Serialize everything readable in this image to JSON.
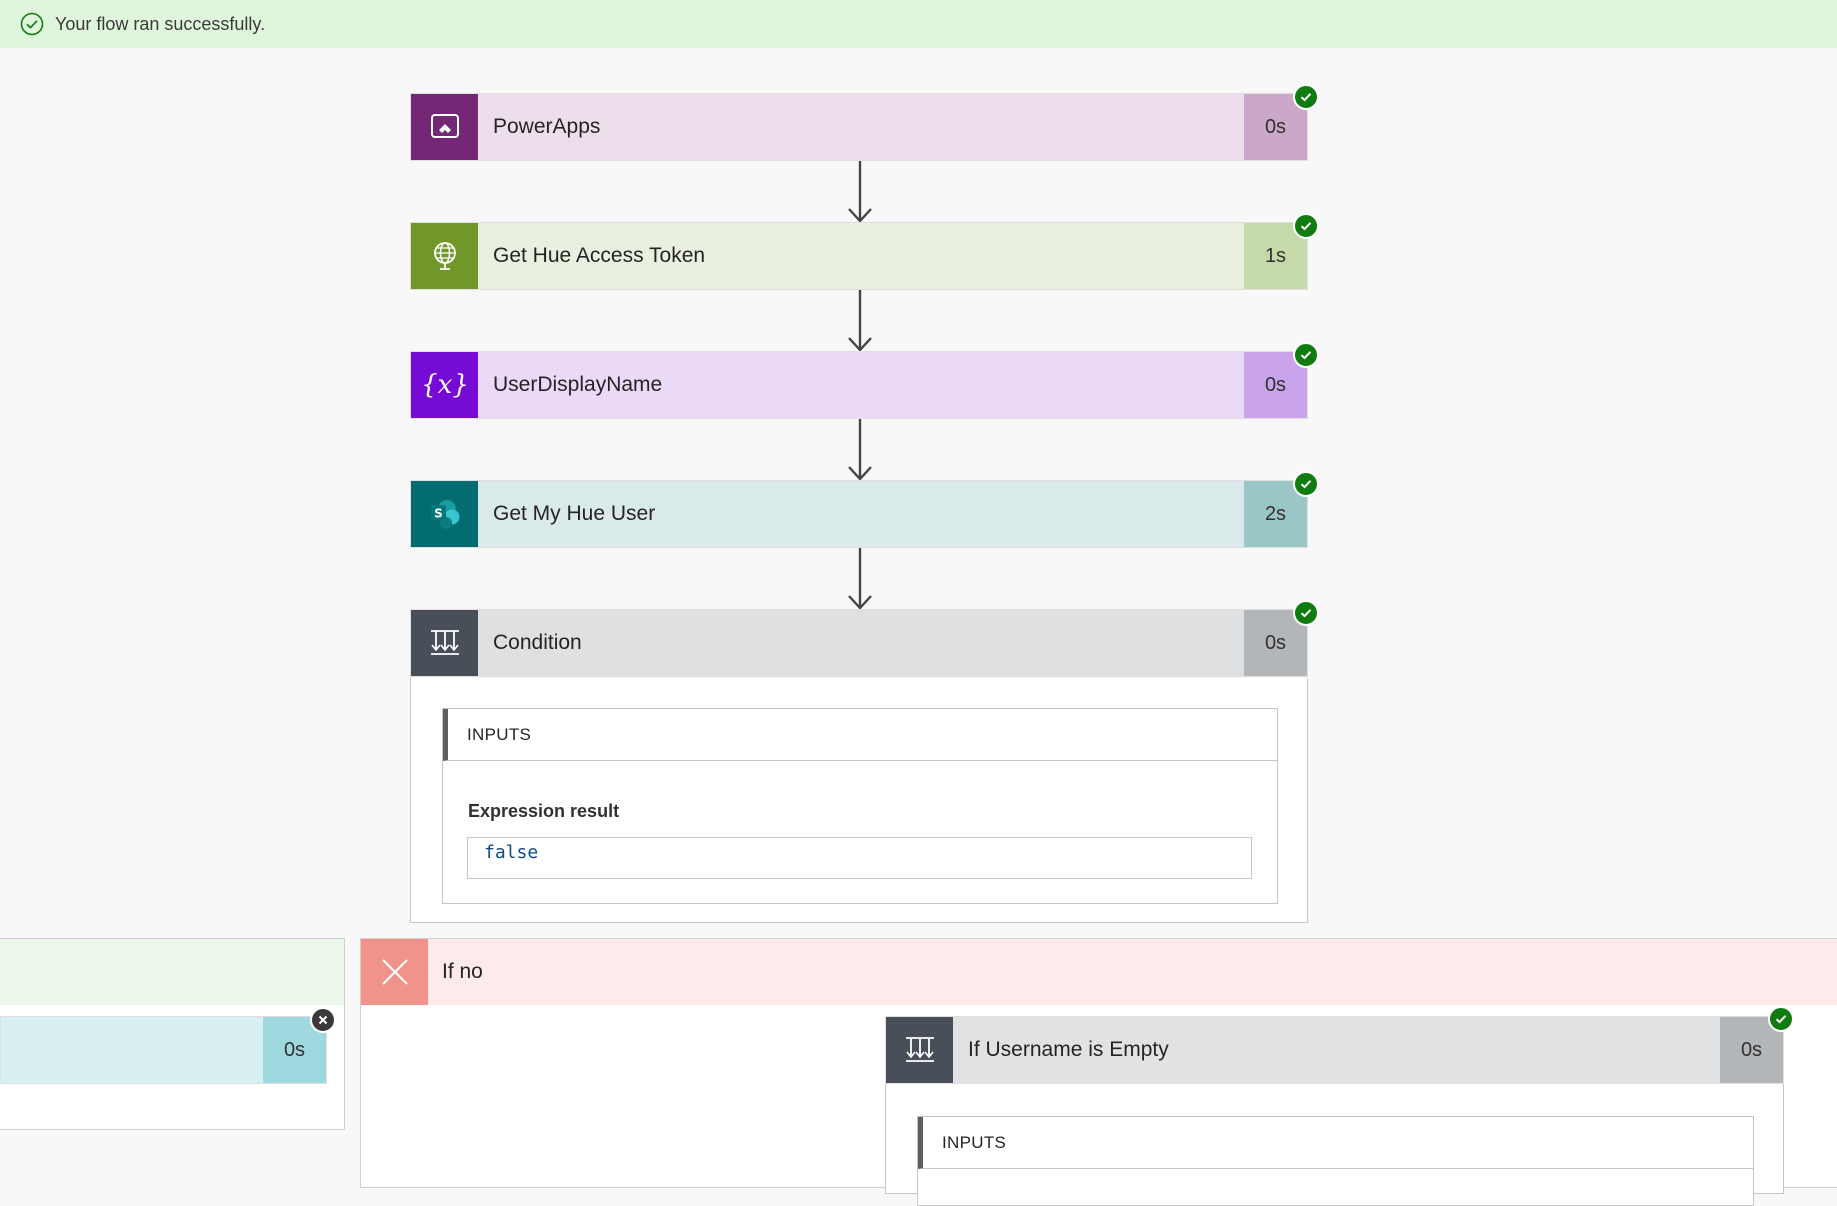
{
  "banner": {
    "message": "Your flow ran successfully."
  },
  "steps": [
    {
      "title": "PowerApps",
      "duration": "0s",
      "icon": "powerapps-icon",
      "accent": "#742774"
    },
    {
      "title": "Get Hue Access Token",
      "duration": "1s",
      "icon": "http-globe-icon",
      "accent": "#709727"
    },
    {
      "title": "UserDisplayName",
      "duration": "0s",
      "icon": "variable-icon",
      "accent": "#770bd6"
    },
    {
      "title": "Get My Hue User",
      "duration": "2s",
      "icon": "sharepoint-icon",
      "accent": "#036c70"
    },
    {
      "title": "Condition",
      "duration": "0s",
      "icon": "condition-icon",
      "accent": "#484f58"
    }
  ],
  "condition": {
    "inputs_header": "INPUTS",
    "expression_label": "Expression result",
    "expression_value": "false"
  },
  "branches": {
    "if_yes": {
      "step_duration": "0s"
    },
    "if_no": {
      "label": "If no",
      "step": {
        "title": "If Username is Empty",
        "duration": "0s",
        "icon": "condition-icon"
      },
      "inputs_header": "INPUTS"
    }
  }
}
